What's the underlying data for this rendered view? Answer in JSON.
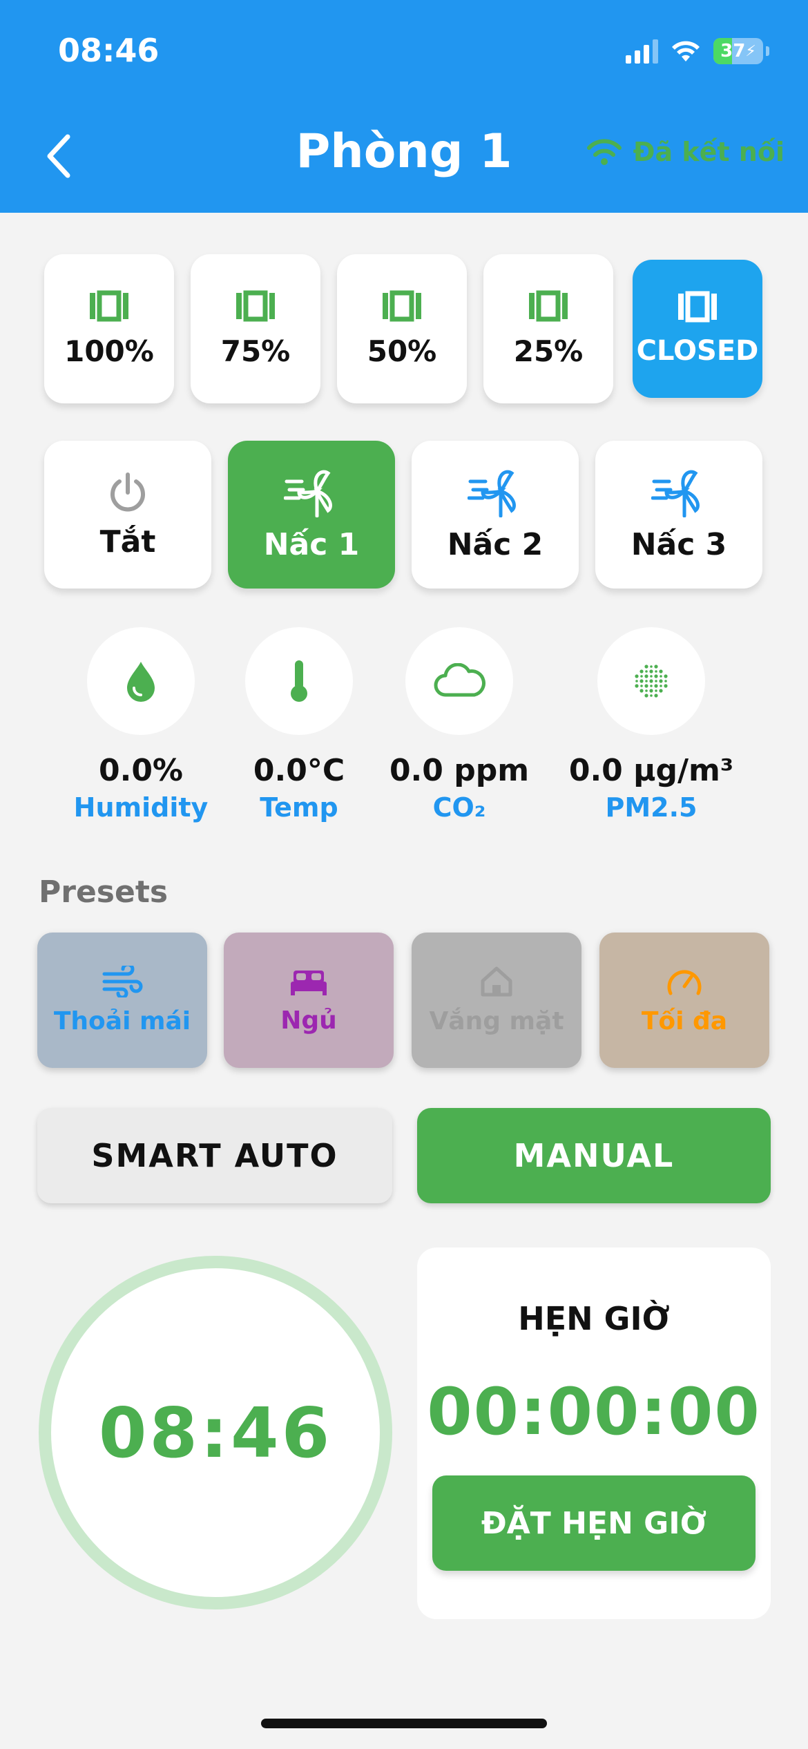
{
  "status_bar": {
    "time": "08:46",
    "battery": "37",
    "battery_level": 0.37
  },
  "header": {
    "title": "Phòng 1",
    "connection": "Đã kết nối",
    "connection_color": "#4caf50",
    "background": "#2196f0"
  },
  "curtain": {
    "options": [
      {
        "label": "100%"
      },
      {
        "label": "75%"
      },
      {
        "label": "50%"
      },
      {
        "label": "25%"
      },
      {
        "label": "CLOSED",
        "active": true
      }
    ]
  },
  "fan": {
    "options": [
      {
        "label": "Tắt",
        "icon": "power-icon"
      },
      {
        "label": "Nấc 1",
        "icon": "fan-icon",
        "active": true
      },
      {
        "label": "Nấc 2",
        "icon": "fan-icon"
      },
      {
        "label": "Nấc 3",
        "icon": "fan-icon"
      }
    ]
  },
  "sensors": [
    {
      "value": "0.0%",
      "label": "Humidity",
      "icon": "droplet-icon"
    },
    {
      "value": "0.0°C",
      "label": "Temp",
      "icon": "thermometer-icon"
    },
    {
      "value": "0.0 ppm",
      "label": "CO₂",
      "icon": "cloud-icon"
    },
    {
      "value": "0.0 µg/m³",
      "label": "PM2.5",
      "icon": "particles-icon"
    }
  ],
  "presets": {
    "title": "Presets",
    "items": [
      {
        "label": "Thoải mái",
        "icon": "wind-icon",
        "color": "#2196f0"
      },
      {
        "label": "Ngủ",
        "icon": "bed-icon",
        "color": "#9c27b0"
      },
      {
        "label": "Vắng mặt",
        "icon": "home-icon",
        "color": "#9e9e9e"
      },
      {
        "label": "Tối đa",
        "icon": "gauge-icon",
        "color": "#ff9800"
      }
    ]
  },
  "modes": {
    "smart_auto": "SMART AUTO",
    "manual": "MANUAL",
    "active": "manual"
  },
  "clock": {
    "time": "08:46"
  },
  "timer": {
    "title": "HẸN GIỜ",
    "value": "00:00:00",
    "button": "ĐẶT HẸN GIỜ"
  }
}
